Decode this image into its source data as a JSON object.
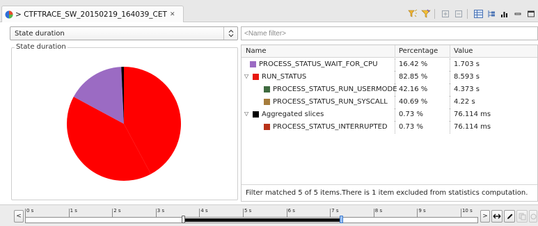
{
  "tab": {
    "title": "> CTFTRACE_SW_20150219_164039_CET",
    "close_glyph": "✕",
    "icon": "pie-chart-icon"
  },
  "toolbar": {
    "icons": [
      "filter-wizard-icon",
      "filter-icon",
      "expand-all-icon",
      "collapse-all-icon",
      "table-view-icon",
      "tree-view-icon",
      "bar-chart-view-icon",
      "minimize-icon",
      "maximize-icon"
    ]
  },
  "left": {
    "combo_value": "State duration",
    "group_label": "State duration"
  },
  "chart_data": {
    "type": "pie",
    "slices": [
      {
        "name": "PROCESS_STATUS_RUN_USERMODE",
        "value": 42.16,
        "color": "#ff0000"
      },
      {
        "name": "PROCESS_STATUS_RUN_SYSCALL",
        "value": 40.69,
        "color": "#ff0000"
      },
      {
        "name": "PROCESS_STATUS_WAIT_FOR_CPU",
        "value": 16.42,
        "color": "#9b6bc3"
      },
      {
        "name": "PROCESS_STATUS_INTERRUPTED",
        "value": 0.73,
        "color": "#000000"
      }
    ]
  },
  "right": {
    "filter_placeholder": "<Name filter>",
    "columns": [
      "Name",
      "Percentage",
      "Value"
    ],
    "rows": [
      {
        "name": "PROCESS_STATUS_WAIT_FOR_CPU",
        "percentage": "16.42 %",
        "value": "1.703 s",
        "color": "#9b6bc3",
        "level": 0,
        "expander": ""
      },
      {
        "name": "RUN_STATUS",
        "percentage": "82.85 %",
        "value": "8.593 s",
        "color": "#e8170f",
        "level": 0,
        "expander": "▽"
      },
      {
        "name": "PROCESS_STATUS_RUN_USERMODE",
        "percentage": "42.16 %",
        "value": "4.373 s",
        "color": "#3f6b40",
        "level": 1,
        "expander": ""
      },
      {
        "name": "PROCESS_STATUS_RUN_SYSCALL",
        "percentage": "40.69 %",
        "value": "4.22 s",
        "color": "#a67c3c",
        "level": 1,
        "expander": ""
      },
      {
        "name": "Aggregated slices",
        "percentage": "0.73 %",
        "value": "76.114 ms",
        "color": "#000000",
        "level": 0,
        "expander": "▽"
      },
      {
        "name": "PROCESS_STATUS_INTERRUPTED",
        "percentage": "0.73 %",
        "value": "76.114 ms",
        "color": "#b83218",
        "level": 1,
        "expander": ""
      }
    ],
    "status": "Filter matched 5 of 5 items.There is 1 item excluded from statistics computation."
  },
  "timebar": {
    "ticks": [
      "0 s",
      "1 s",
      "2 s",
      "3 s",
      "4 s",
      "5 s",
      "6 s",
      "7 s",
      "8 s",
      "9 s",
      "10 s"
    ],
    "range_start": 0,
    "range_end": 10.4,
    "selection_start": 3.62,
    "selection_end": 7.25,
    "left_arrow": "<",
    "right_arrow": ">",
    "button_icons": [
      "expand-range-icon",
      "pencil-icon",
      "copy-icon",
      "reset-icon"
    ]
  }
}
